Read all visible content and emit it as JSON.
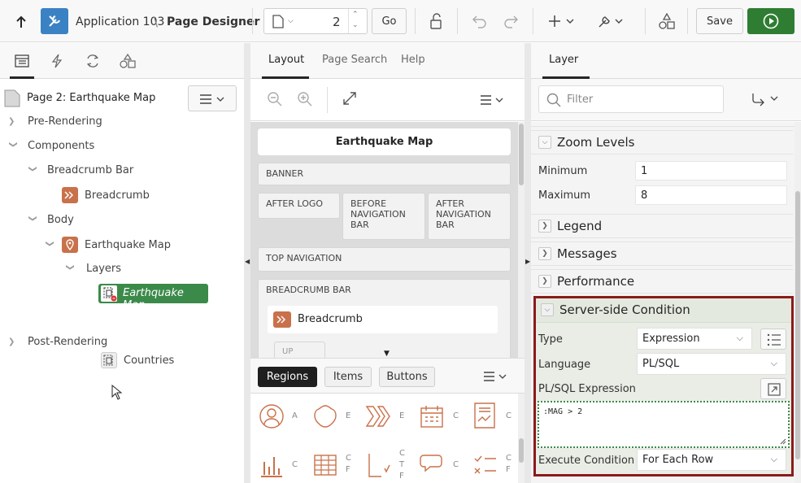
{
  "toolbar": {
    "app_label": "Application 103",
    "separator": "\\",
    "page_designer_label": "Page Designer",
    "page_number": "2",
    "go_label": "Go",
    "save_label": "Save"
  },
  "left": {
    "page_title": "Page 2: Earthquake Map",
    "tree": {
      "pre_rendering": "Pre-Rendering",
      "components": "Components",
      "breadcrumb_bar": "Breadcrumb Bar",
      "breadcrumb": "Breadcrumb",
      "body": "Body",
      "earthquake_map": "Earthquake Map",
      "layers": "Layers",
      "layer_earthquake_map": "Earthquake Map",
      "layer_countries": "Countries",
      "post_rendering": "Post-Rendering"
    }
  },
  "middle": {
    "tabs": [
      "Layout",
      "Page Search",
      "Help"
    ],
    "layout": {
      "page_title": "Earthquake Map",
      "banner": "BANNER",
      "after_logo": "AFTER LOGO",
      "before_nav_bar": "BEFORE NAVIGATION BAR",
      "after_nav_bar": "AFTER NAVIGATION BAR",
      "top_navigation": "TOP NAVIGATION",
      "breadcrumb_bar": "BREADCRUMB BAR",
      "breadcrumb": "Breadcrumb",
      "cut_label": "UP"
    },
    "gallery_tabs": [
      "Regions",
      "Items",
      "Buttons"
    ],
    "gallery_letters": [
      "A",
      "E",
      "E",
      "C",
      "C",
      "C",
      "C",
      "C",
      "C",
      "C",
      "C",
      "C"
    ],
    "gallery_letters_2": [
      "",
      "",
      "F",
      "",
      "T",
      "",
      "F",
      "",
      "",
      "F",
      "",
      ""
    ]
  },
  "right": {
    "tab": "Layer",
    "filter_placeholder": "Filter",
    "groups": {
      "zoom_levels": "Zoom Levels",
      "legend": "Legend",
      "messages": "Messages",
      "performance": "Performance",
      "server_side_condition": "Server-side Condition"
    },
    "zoom": {
      "minimum_label": "Minimum",
      "minimum_value": "1",
      "maximum_label": "Maximum",
      "maximum_value": "8"
    },
    "condition": {
      "type_label": "Type",
      "type_value": "Expression",
      "language_label": "Language",
      "language_value": "PL/SQL",
      "expression_label": "PL/SQL Expression",
      "expression_value": ":MAG > 2",
      "execute_label": "Execute Condition",
      "execute_value": "For Each Row"
    }
  },
  "colors": {
    "accent_blue": "#3a82c4",
    "run_green": "#2e7d32",
    "selected_green": "#3b8a4a",
    "highlight_border": "#8b1a1a",
    "icon_orange": "#c9714a"
  }
}
